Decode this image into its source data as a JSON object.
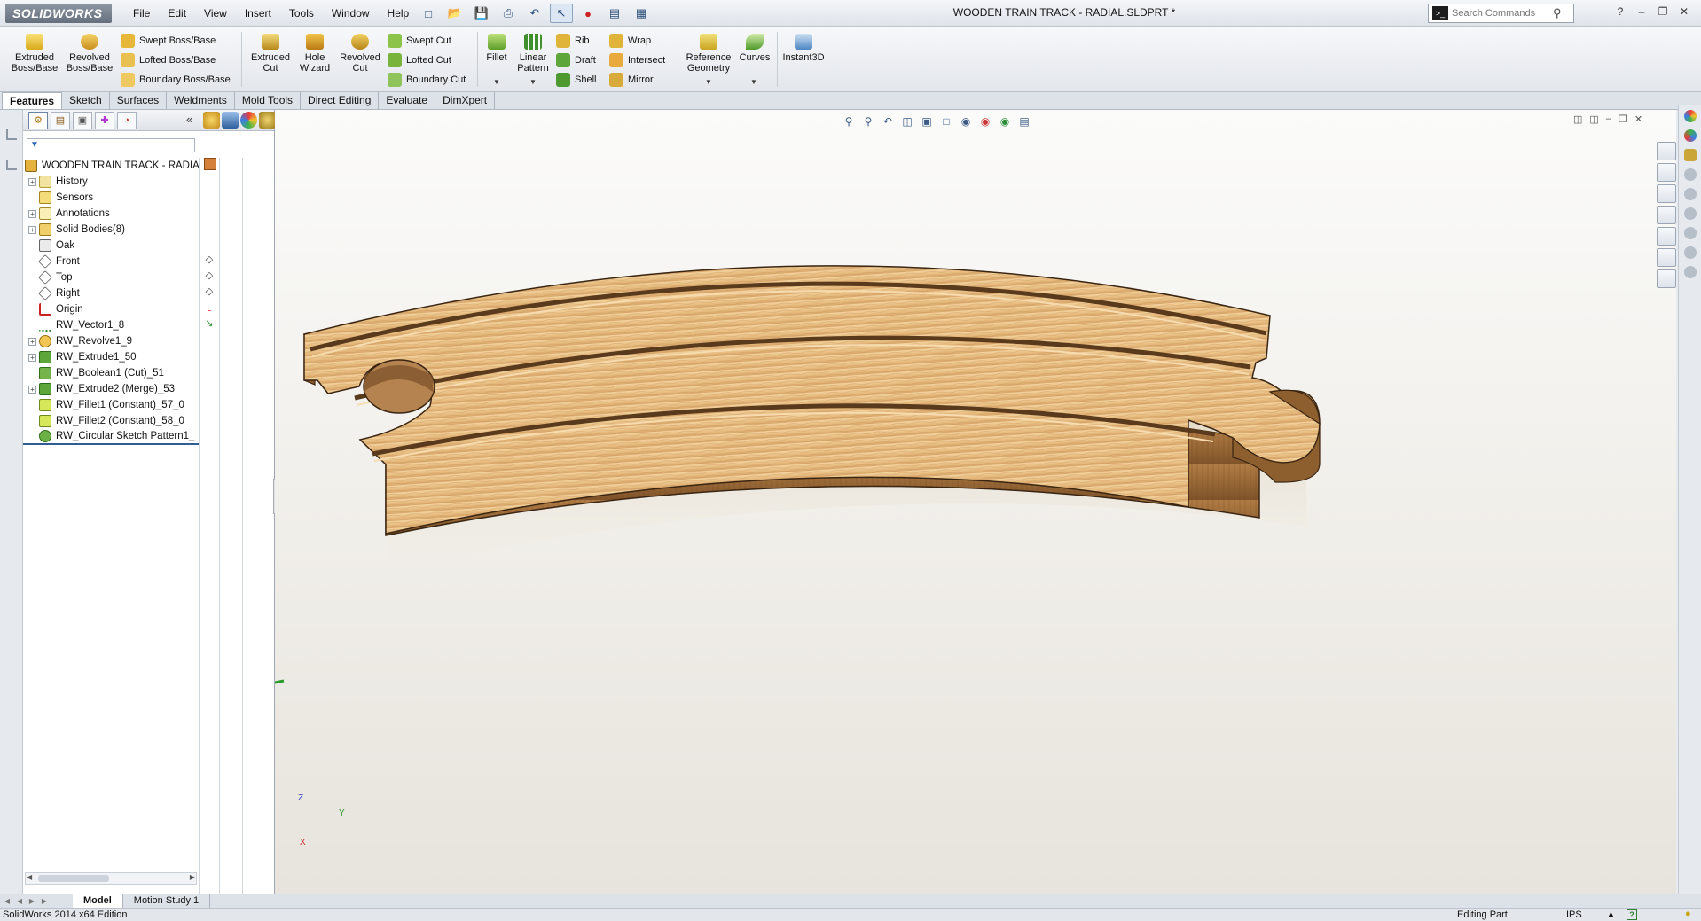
{
  "app": {
    "logo": "SOLIDWORKS",
    "title": "WOODEN TRAIN TRACK - RADIAL.SLDPRT *",
    "menu": [
      "File",
      "Edit",
      "View",
      "Insert",
      "Tools",
      "Window",
      "Help"
    ],
    "search_placeholder": "Search Commands"
  },
  "commands": {
    "extruded_boss": "Extruded Boss/Base",
    "revolved_boss": "Revolved Boss/Base",
    "swept_boss": "Swept Boss/Base",
    "lofted_boss": "Lofted Boss/Base",
    "boundary_boss": "Boundary Boss/Base",
    "extruded_cut": "Extruded Cut",
    "hole_wizard": "Hole Wizard",
    "revolved_cut": "Revolved Cut",
    "swept_cut": "Swept Cut",
    "lofted_cut": "Lofted Cut",
    "boundary_cut": "Boundary Cut",
    "fillet": "Fillet",
    "linear_pattern": "Linear Pattern",
    "rib": "Rib",
    "draft": "Draft",
    "shell": "Shell",
    "wrap": "Wrap",
    "intersect": "Intersect",
    "mirror": "Mirror",
    "reference_geometry": "Reference Geometry",
    "curves": "Curves",
    "instant3d": "Instant3D"
  },
  "tabs": [
    "Features",
    "Sketch",
    "Surfaces",
    "Weldments",
    "Mold Tools",
    "Direct Editing",
    "Evaluate",
    "DimXpert"
  ],
  "tree": {
    "root": "WOODEN TRAIN TRACK - RADIA",
    "items": [
      {
        "label": "History",
        "icon": "history-icon",
        "expandable": true
      },
      {
        "label": "Sensors",
        "icon": "sensors-icon",
        "expandable": false
      },
      {
        "label": "Annotations",
        "icon": "annotations-icon",
        "expandable": true
      },
      {
        "label": "Solid Bodies(8)",
        "icon": "solid-bodies-icon",
        "expandable": true
      },
      {
        "label": "Oak",
        "icon": "material-icon",
        "expandable": false
      },
      {
        "label": "Front",
        "icon": "plane-icon",
        "expandable": false
      },
      {
        "label": "Top",
        "icon": "plane-icon",
        "expandable": false
      },
      {
        "label": "Right",
        "icon": "plane-icon",
        "expandable": false
      },
      {
        "label": "Origin",
        "icon": "origin-icon",
        "expandable": false
      },
      {
        "label": "RW_Vector1_8",
        "icon": "vector-icon",
        "expandable": false
      },
      {
        "label": "RW_Revolve1_9",
        "icon": "revolve-icon",
        "expandable": true
      },
      {
        "label": "RW_Extrude1_50",
        "icon": "extrude-icon",
        "expandable": true
      },
      {
        "label": "RW_Boolean1 (Cut)_51",
        "icon": "boolean-icon",
        "expandable": false
      },
      {
        "label": "RW_Extrude2 (Merge)_53",
        "icon": "extrude-icon",
        "expandable": true
      },
      {
        "label": "RW_Fillet1 (Constant)_57_0",
        "icon": "fillet-icon",
        "expandable": false
      },
      {
        "label": "RW_Fillet2 (Constant)_58_0",
        "icon": "fillet-icon",
        "expandable": false
      },
      {
        "label": "RW_Circular Sketch Pattern1_",
        "icon": "pattern-icon",
        "expandable": false
      }
    ]
  },
  "bottom_tabs": [
    "Model",
    "Motion Study 1"
  ],
  "status": {
    "left": "SolidWorks 2014 x64 Edition",
    "mode": "Editing Part",
    "units": "IPS",
    "help": "?"
  },
  "triad": {
    "y": "Y",
    "z": "Z",
    "x": "X"
  },
  "colors": {
    "wood_light": "#eac48e",
    "wood_mid": "#d6a362",
    "wood_dark": "#9d6a33",
    "viewport_bg": "#f1efea",
    "accent": "#2f5d96"
  }
}
